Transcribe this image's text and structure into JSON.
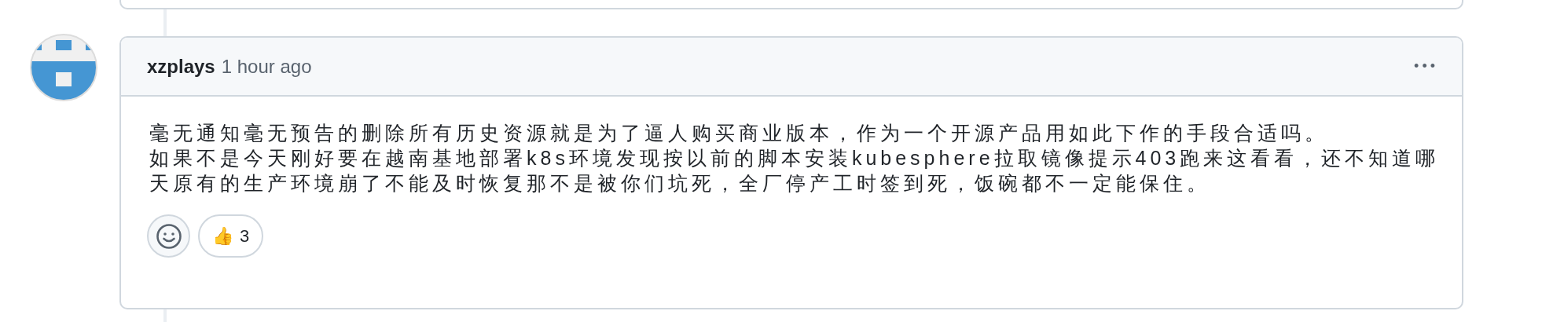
{
  "comment": {
    "author": "xzplays",
    "time": "1 hour ago",
    "menu": "•••",
    "paragraphs": [
      "毫无通知毫无预告的删除所有历史资源就是为了逼人购买商业版本，作为一个开源产品用如此下作的手段合适吗。",
      "如果不是今天刚好要在越南基地部署k8s环境发现按以前的脚本安装kubesphere拉取镜像提示403跑来这看看，还不知道哪天原有的生产环境崩了不能及时恢复那不是被你们坑死，全厂停产工时签到死，饭碗都不一定能保住。"
    ],
    "reactions": [
      {
        "emoji": "👍",
        "count": "3",
        "selected": false
      }
    ]
  }
}
